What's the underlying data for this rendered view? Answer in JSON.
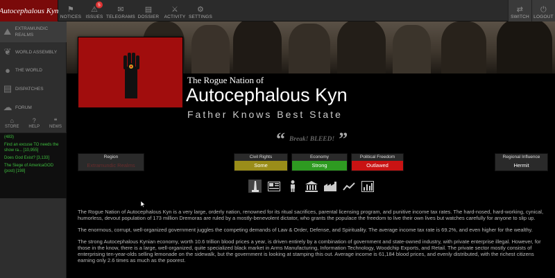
{
  "header": {
    "nation_badge": "Autocephalous Kyn",
    "nav": [
      {
        "label": "NOTICES",
        "icon": "notice-icon"
      },
      {
        "label": "ISSUES",
        "icon": "issues-icon",
        "badge": "5"
      },
      {
        "label": "TELEGRAMS",
        "icon": "telegram-icon"
      },
      {
        "label": "DOSSIER",
        "icon": "dossier-icon"
      },
      {
        "label": "ACTIVITY",
        "icon": "activity-icon"
      },
      {
        "label": "SETTINGS",
        "icon": "gear-icon"
      }
    ],
    "right": [
      {
        "label": "SWITCH"
      },
      {
        "label": "LOGOUT"
      }
    ]
  },
  "sidebar": {
    "items": [
      {
        "label": "EXTRAMUNDIC REALMS",
        "icon": "region-icon"
      },
      {
        "label": "WORLD ASSEMBLY",
        "icon": "wa-icon"
      },
      {
        "label": "THE WORLD",
        "icon": "globe-icon"
      },
      {
        "label": "DISPATCHES",
        "icon": "dispatch-icon"
      },
      {
        "label": "FORUM",
        "icon": "forum-icon"
      }
    ],
    "util": [
      {
        "label": "STORE",
        "icon": "store-icon"
      },
      {
        "label": "HELP",
        "icon": "help-icon"
      },
      {
        "label": "NEWS",
        "icon": "news-icon"
      }
    ],
    "feed": [
      "(483)",
      "Find an excuse TO needs the show ra... [10,955]",
      "Does God Exist? [3,133]",
      "The Siege of AmericaGOD (post) [198]"
    ]
  },
  "nation": {
    "pretitle": "The Rogue Nation of",
    "name": "Autocephalous Kyn",
    "motto_line": "Father Knows Best State",
    "quote": "Break! BLEED!"
  },
  "stats": {
    "region": {
      "title": "Region",
      "value": "Extramundic Realms"
    },
    "civil": {
      "title": "Civil Rights",
      "value": "Some"
    },
    "economy": {
      "title": "Economy",
      "value": "Strong"
    },
    "political": {
      "title": "Political Freedom",
      "value": "Outlawed"
    },
    "influence": {
      "title": "Regional Influence",
      "value": "Hermit"
    }
  },
  "description": [
    "The Rogue Nation of Autocephalous Kyn is a very large, orderly nation, renowned for its ritual sacrifices, parental licensing program, and punitive income tax rates. The hard-nosed, hard-working, cynical, humorless, devout population of 173 million Dremoras are ruled by a mostly-benevolent dictator, who grants the populace the freedom to live their own lives but watches carefully for anyone to slip up.",
    "The enormous, corrupt, well-organized government juggles the competing demands of Law & Order, Defense, and Spirituality. The average income tax rate is 69.2%, and even higher for the wealthy.",
    "The strong Autocephalous Kynian economy, worth 10.6 trillion blood prices a year, is driven entirely by a combination of government and state-owned industry, with private enterprise illegal. However, for those in the know, there is a large, well-organized, quite specialized black market in Arms Manufacturing, Information Technology, Woodchip Exports, and Retail. The private sector mostly consists of enterprising ten-year-olds selling lemonade on the sidewalk, but the government is looking at stamping this out. Average income is 61,184 blood prices, and evenly distributed, with the richest citizens earning only 2.6 times as much as the poorest."
  ],
  "category_icons": [
    "monument-icon",
    "newspaper-icon",
    "person-icon",
    "government-icon",
    "factory-icon",
    "trend-icon",
    "bar-chart-icon"
  ]
}
